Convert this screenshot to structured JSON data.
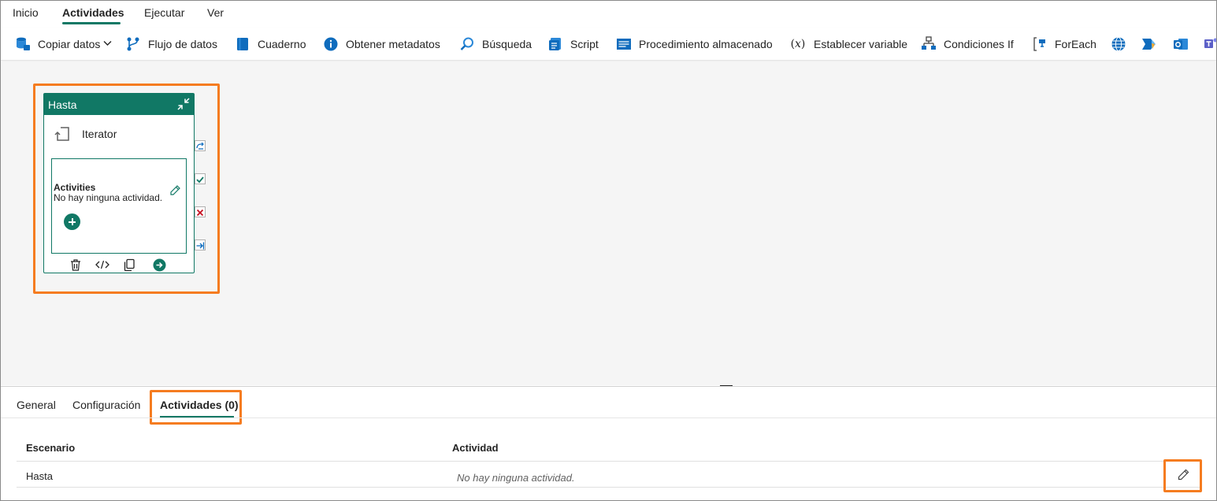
{
  "menu": {
    "tabs": [
      {
        "label": "Inicio"
      },
      {
        "label": "Actividades",
        "active": true
      },
      {
        "label": "Ejecutar"
      },
      {
        "label": "Ver"
      }
    ]
  },
  "ribbon": {
    "items": [
      {
        "label": "Copiar datos",
        "icon": "database-icon",
        "has_dropdown": true
      },
      {
        "label": "Flujo de datos",
        "icon": "dataflow-icon"
      },
      {
        "label": "Cuaderno",
        "icon": "notebook-icon"
      },
      {
        "label": "Obtener metadatos",
        "icon": "info-icon"
      },
      {
        "label": "Búsqueda",
        "icon": "lookup-icon"
      },
      {
        "label": "Script",
        "icon": "script-icon"
      },
      {
        "label": "Procedimiento almacenado",
        "icon": "stored-procedure-icon"
      },
      {
        "label": "Establecer variable",
        "icon": "variable-icon",
        "glyph": "(𝑥)"
      },
      {
        "label": "Condiciones If",
        "icon": "if-condition-icon"
      },
      {
        "label": "ForEach",
        "icon": "foreach-icon"
      }
    ],
    "extra_icons": [
      "web-icon",
      "power-automate-icon",
      "outlook-icon",
      "teams-icon"
    ]
  },
  "canvas": {
    "activity_card": {
      "title": "Hasta",
      "type_label": "Iterator",
      "activities_title": "Activities",
      "activities_empty": "No hay ninguna actividad."
    }
  },
  "panel": {
    "tabs": [
      {
        "label": "General"
      },
      {
        "label": "Configuración"
      },
      {
        "label": "Actividades (0)",
        "active": true
      }
    ],
    "table": {
      "columns": [
        "Escenario",
        "Actividad"
      ],
      "rows": [
        {
          "scenario": "Hasta",
          "activity": "No hay ninguna actividad."
        }
      ]
    }
  },
  "colors": {
    "accent": "#117865",
    "highlight": "#f57c20",
    "canvas_bg": "#f5f5f5"
  }
}
